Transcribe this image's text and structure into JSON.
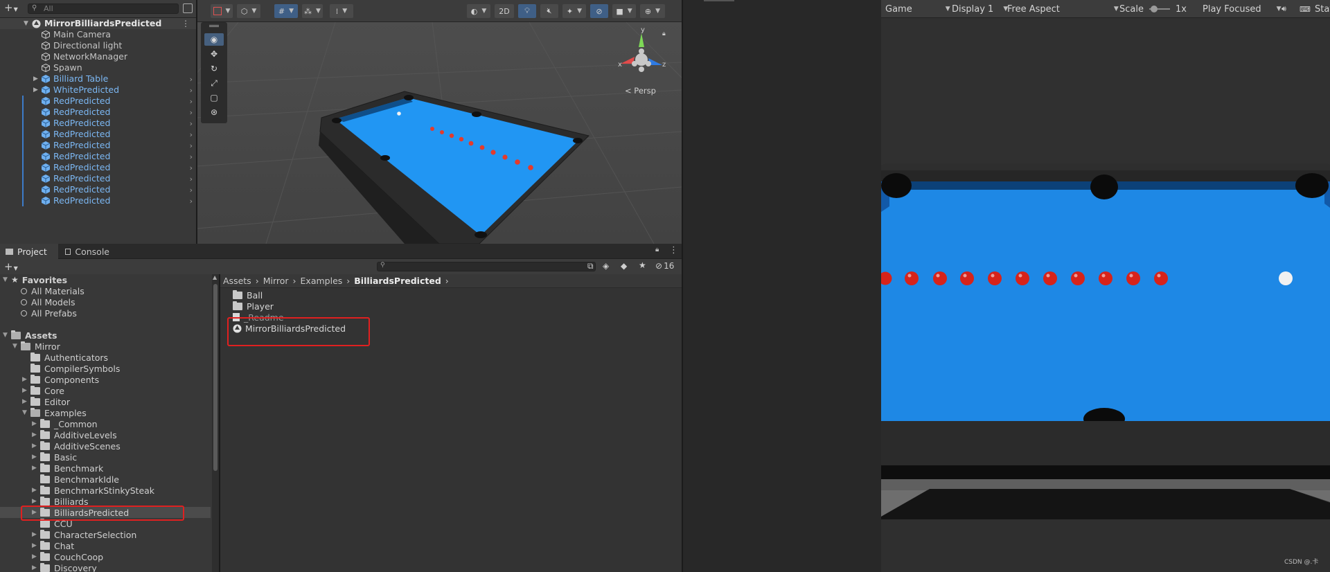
{
  "hierarchy": {
    "search_placeholder": "All",
    "scene_name": "MirrorBilliardsPredicted",
    "items": [
      {
        "label": "Main Camera",
        "blue": false,
        "expandable": false
      },
      {
        "label": "Directional light",
        "blue": false,
        "expandable": false
      },
      {
        "label": "NetworkManager",
        "blue": false,
        "expandable": false
      },
      {
        "label": "Spawn",
        "blue": false,
        "expandable": false
      },
      {
        "label": "Billiard Table",
        "blue": true,
        "expandable": true
      },
      {
        "label": "WhitePredicted",
        "blue": true,
        "expandable": true
      },
      {
        "label": "RedPredicted",
        "blue": true,
        "expandable": false
      },
      {
        "label": "RedPredicted",
        "blue": true,
        "expandable": false
      },
      {
        "label": "RedPredicted",
        "blue": true,
        "expandable": false
      },
      {
        "label": "RedPredicted",
        "blue": true,
        "expandable": false
      },
      {
        "label": "RedPredicted",
        "blue": true,
        "expandable": false
      },
      {
        "label": "RedPredicted",
        "blue": true,
        "expandable": false
      },
      {
        "label": "RedPredicted",
        "blue": true,
        "expandable": false
      },
      {
        "label": "RedPredicted",
        "blue": true,
        "expandable": false
      },
      {
        "label": "RedPredicted",
        "blue": true,
        "expandable": false
      },
      {
        "label": "RedPredicted",
        "blue": true,
        "expandable": false
      }
    ]
  },
  "scene": {
    "toggle_2d": "2D",
    "projection_label": "Persp",
    "gizmo_axes": {
      "x": "x",
      "y": "y",
      "z": "z"
    }
  },
  "project_panel": {
    "tabs": {
      "project": "Project",
      "console": "Console"
    },
    "hidden_count": "16",
    "favorites": {
      "title": "Favorites",
      "items": [
        "All Materials",
        "All Models",
        "All Prefabs"
      ]
    },
    "assets_root": "Assets",
    "tree": [
      {
        "label": "Mirror",
        "open": true
      },
      {
        "label": "Authenticators",
        "arrow": false
      },
      {
        "label": "CompilerSymbols",
        "arrow": false
      },
      {
        "label": "Components",
        "arrow": true
      },
      {
        "label": "Core",
        "arrow": true
      },
      {
        "label": "Editor",
        "arrow": true
      },
      {
        "label": "Examples",
        "open": true
      },
      {
        "label": "_Common",
        "arrow": true
      },
      {
        "label": "AdditiveLevels",
        "arrow": true
      },
      {
        "label": "AdditiveScenes",
        "arrow": true
      },
      {
        "label": "Basic",
        "arrow": true
      },
      {
        "label": "Benchmark",
        "arrow": true
      },
      {
        "label": "BenchmarkIdle",
        "arrow": false
      },
      {
        "label": "BenchmarkStinkySteak",
        "arrow": true
      },
      {
        "label": "Billiards",
        "arrow": true
      },
      {
        "label": "BilliardsPredicted",
        "arrow": true,
        "selected": true
      },
      {
        "label": "CCU",
        "arrow": false
      },
      {
        "label": "CharacterSelection",
        "arrow": true
      },
      {
        "label": "Chat",
        "arrow": true
      },
      {
        "label": "CouchCoop",
        "arrow": true
      },
      {
        "label": "Discovery",
        "arrow": true
      }
    ],
    "breadcrumb": [
      "Assets",
      "Mirror",
      "Examples",
      "BilliardsPredicted"
    ],
    "contents": [
      {
        "label": "Ball",
        "kind": "folder"
      },
      {
        "label": "Player",
        "kind": "folder"
      },
      {
        "label": "_Readme",
        "kind": "doc"
      },
      {
        "label": "MirrorBilliardsPredicted",
        "kind": "scene"
      }
    ]
  },
  "game_view": {
    "tab": "Game",
    "display": "Display 1",
    "aspect": "Free Aspect",
    "scale_label": "Scale",
    "scale_value": "1x",
    "play_mode": "Play Focused",
    "stats": "Stat",
    "watermark": "CSDN @.卡"
  },
  "colors": {
    "felt": "#1e88e5",
    "selection": "#2c5d87",
    "annotation": "#e02020",
    "prefab_blue": "#7cb8f4"
  }
}
